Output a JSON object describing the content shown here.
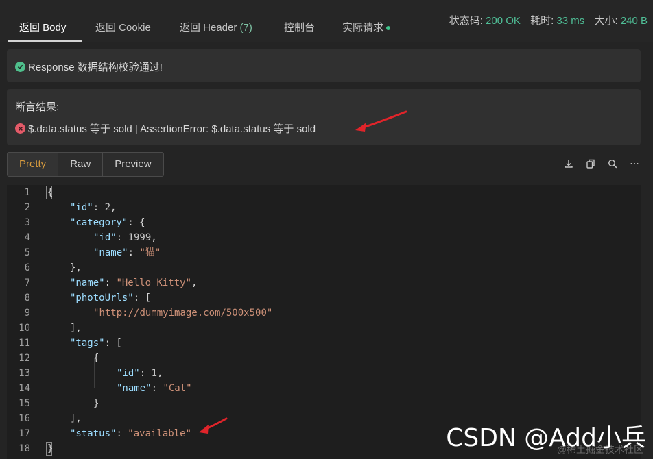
{
  "tabs": [
    {
      "label": "返回 Body"
    },
    {
      "label": "返回 Cookie"
    },
    {
      "label": "返回 Header",
      "count": "(7)"
    },
    {
      "label": "控制台"
    },
    {
      "label": "实际请求"
    }
  ],
  "stats": {
    "status_label": "状态码:",
    "status_value": "200 OK",
    "time_label": "耗时:",
    "time_value": "33 ms",
    "size_label": "大小:",
    "size_value": "240 B"
  },
  "schema": {
    "message": "Response 数据结构校验通过!"
  },
  "assertion": {
    "title": "断言结果:",
    "message": "$.data.status 等于 sold | AssertionError: $.data.status 等于 sold"
  },
  "view": {
    "pretty": "Pretty",
    "raw": "Raw",
    "preview": "Preview"
  },
  "toolbar": {
    "icons": [
      "download-icon",
      "copy-icon",
      "search-icon",
      "more-icon"
    ]
  },
  "code": {
    "line_numbers": [
      "1",
      "2",
      "3",
      "4",
      "5",
      "6",
      "7",
      "8",
      "9",
      "10",
      "11",
      "12",
      "13",
      "14",
      "15",
      "16",
      "17",
      "18"
    ],
    "lines": [
      {
        "t": "{"
      },
      {
        "k": "\"id\"",
        "t": ": ",
        "n": "2",
        "e": ","
      },
      {
        "k": "\"category\"",
        "t": ": {"
      },
      {
        "k": "\"id\"",
        "t": ": ",
        "n": "1999",
        "e": ","
      },
      {
        "k": "\"name\"",
        "t": ": ",
        "s": "\"猫\""
      },
      {
        "t": "},"
      },
      {
        "k": "\"name\"",
        "t": ": ",
        "s": "\"Hello Kitty\"",
        "e": ","
      },
      {
        "k": "\"photoUrls\"",
        "t": ": ["
      },
      {
        "q1": "\"",
        "u": "http://dummyimage.com/500x500",
        "q2": "\""
      },
      {
        "t": "],"
      },
      {
        "k": "\"tags\"",
        "t": ": ["
      },
      {
        "t": "{"
      },
      {
        "k": "\"id\"",
        "t": ": ",
        "n": "1",
        "e": ","
      },
      {
        "k": "\"name\"",
        "t": ": ",
        "s": "\"Cat\""
      },
      {
        "t": "}"
      },
      {
        "t": "],"
      },
      {
        "k": "\"status\"",
        "t": ": ",
        "s": "\"available\""
      },
      {
        "t": "}"
      }
    ]
  },
  "watermark": {
    "main": "CSDN @Add小兵",
    "sub": "@稀土掘金技术社区"
  },
  "colors": {
    "accent_green": "#4fbe96",
    "error_red": "#e35a68",
    "active_orange": "#d99c3e",
    "annotation_red": "#e0242a"
  }
}
